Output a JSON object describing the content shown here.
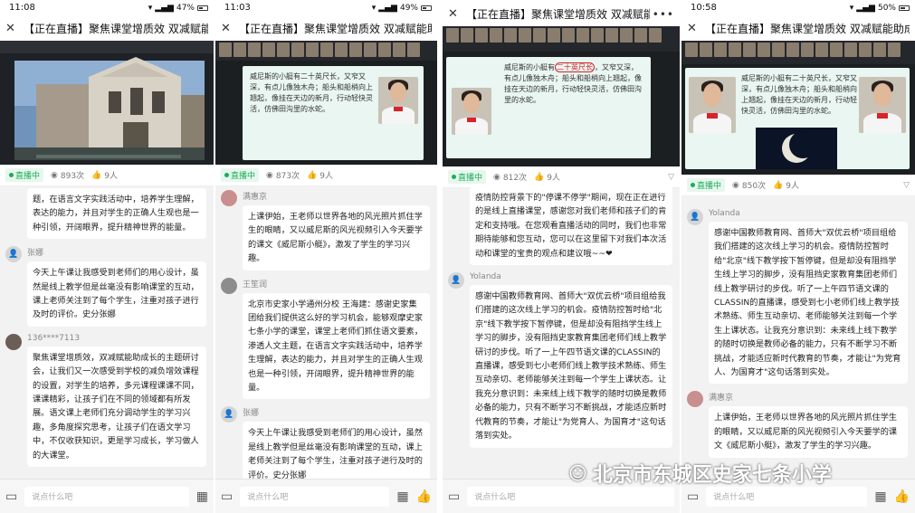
{
  "panels": [
    {
      "time": "11:08",
      "battery": "47%",
      "title": "【正在直播】聚焦课堂增质效 双减赋能助成长",
      "live": "直播中",
      "views": "893次",
      "likes": "9人",
      "input_placeholder": "说点什么吧",
      "comments": [
        {
          "name": "",
          "text": "题，在语言文字实践活动中，培养学生理解，表达的能力，并且对学生的正确人生观也是一种引领，开阔眼界，提升精神世界的能量。"
        },
        {
          "name": "张娜",
          "text": "今天上午课让我感受到老师们的用心设计，虽然是线上教学但是丝毫没有影响课堂的互动，课上老师关注到了每个学生，注重对孩子进行及时的评价。史分张娜"
        },
        {
          "name": "136****7113",
          "text": "聚焦课堂增质效，双减赋能助成长的主题研讨会，让我们又一次感受到学校的减负增效课程的设置，对学生的培养，多元课程课课不同，课课精彩，让孩子们在不同的领域都有所发展。语文课上老师们充分调动学生的学习兴趣，多角度探究思考，让孩子们在语文学习中，不仅收获知识，更是学习成长，学习做人的大课堂。"
        }
      ]
    },
    {
      "time": "11:03",
      "battery": "49%",
      "title": "【正在直播】聚焦课堂增质效 双减赋能助成长",
      "live": "直播中",
      "views": "873次",
      "likes": "9人",
      "input_placeholder": "说点什么吧",
      "slide_text": "威尼斯的小艇有二十英尺长，又窄又深，有点儿像独木舟；船头和船梢向上翘起，像挂在天边的新月，行动轻快灵活，仿佛田沟里的水蛇。",
      "comments": [
        {
          "name": "满惠京",
          "text": "上课伊始，王老师以世界各地的风光照片抓住学生的眼睛，又以威尼斯的风光视频引入今天要学的课文《威尼斯小艇》，激发了学生的学习兴趣。"
        },
        {
          "name": "王笙润",
          "text": "北京市史家小学通州分校 王海建：感谢史家集团给我们提供这么好的学习机会，能够观摩史家七条小学的课堂，课堂上老师们抓住语文要素，渗透人文主题，在语言文字实践活动中，培养学生理解，表达的能力，并且对学生的正确人生观也是一种引领，开阔眼界，提升精神世界的能量。"
        },
        {
          "name": "张娜",
          "text": "今天上午课让我感受到老师们的用心设计，虽然是线上教学但是丝毫没有影响课堂的互动，课上老师关注到了每个学生，注重对孩子进行及时的评价。史分张娜"
        }
      ]
    },
    {
      "time": "",
      "battery": "",
      "title": "【正在直播】聚焦课堂增质效 双减赋能助成长",
      "live": "直播中",
      "views": "812次",
      "likes": "9人",
      "input_placeholder": "说点什么吧",
      "slide_text_a": "威尼斯的小艇有",
      "slide_text_b": "二十英尺长",
      "slide_text_c": "，又窄又深，有点儿像独木舟；船头和船梢向上翘起，像挂在天边的新月，行动轻快灵活，仿佛田沟里的水蛇。",
      "comments": [
        {
          "name": "",
          "text": "疫情防控背景下的\"停课不停学\"期间，现在正在进行的是线上直播课堂，感谢您对我们老师和孩子们的肯定和支持哦。在您观看直播活动的同时，我们也非常期待能够和您互动，您可以在这里留下对我们本次活动和课堂的宝贵的观点和建议哦~~❤"
        },
        {
          "name": "Yolanda",
          "text": "感谢中国教师教育网、首师大\"双优云桥\"项目组给我们搭建的这次线上学习的机会。疫情防控暂时给\"北京\"线下教学按下暂停键，但是却没有阻挡学生线上学习的脚步，没有阻挡史家教育集团老师们线上教学研讨的步伐。听了一上午四节语文课的CLASSIN的直播课，感受到七小老师们线上教学技术熟练、师生互动亲切、老师能够关注到每一个学生上课状态。让我充分意识到：未来线上线下教学的随时切换是教师必备的能力，只有不断学习不断挑战，才能适应新时代教育的节奏，才能让\"为党育人、为国育才\"这句话落到实处。"
        }
      ]
    },
    {
      "time": "10:58",
      "battery": "50%",
      "title": "【正在直播】聚焦课堂增质效 双减赋能助成长",
      "live": "直播中",
      "views": "850次",
      "likes": "9人",
      "input_placeholder": "说点什么吧",
      "slide_text": "威尼斯的小艇有二十英尺长，又窄又深，有点儿像独木舟；船头和船梢向上翘起，像挂在天边的新月，行动轻快灵活，仿佛田沟里的水蛇。",
      "comments": [
        {
          "name": "Yolanda",
          "text": "感谢中国教师教育网、首师大\"双优云桥\"项目组给我们搭建的这次线上学习的机会。疫情防控暂时给\"北京\"线下教学按下暂停键，但是却没有阻挡学生线上学习的脚步，没有阻挡史家教育集团老师们线上教学研讨的步伐。听了一上午四节语文课的CLASSIN的直播课，感受到七小老师们线上教学技术熟练、师生互动亲切、老师能够关注到每一个学生上课状态。让我充分意识到：未来线上线下教学的随时切换是教师必备的能力，只有不断学习不断挑战，才能适应新时代教育的节奏，才能让\"为党育人、为国育才\"这句话落到实处。"
        },
        {
          "name": "满惠京",
          "text": "上课伊始，王老师以世界各地的风光照片抓住学生的眼睛，又以威尼斯的风光视频引入今天要学的课文《威尼斯小艇》，激发了学生的学习兴趣。"
        }
      ]
    }
  ],
  "watermark": "北京市东城区史家七条小学",
  "colors": {
    "live_green": "#1aad57",
    "highlight_red": "#d2242a",
    "slide_bg": "#e9f6f1"
  }
}
